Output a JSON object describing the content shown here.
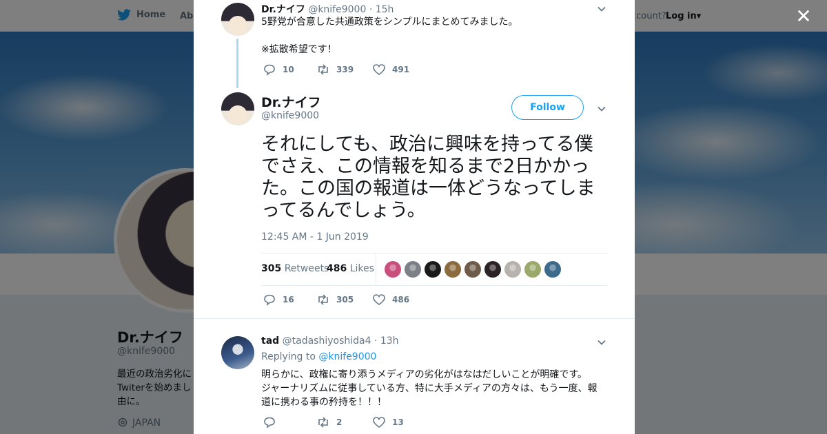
{
  "background": {
    "nav": {
      "home_label": "Home",
      "about_label": "Abo",
      "account_text": "ccount?",
      "login_label": "Log in"
    },
    "profile": {
      "name": "Dr.ナイフ",
      "handle": "@knife9000",
      "bio": "最近の政治劣化に\nTwiterを始めまし\n由に。",
      "location": "JAPAN"
    }
  },
  "close_label": "✕",
  "tweets": {
    "parent": {
      "name": "Dr.ナイフ",
      "handle": "@knife9000",
      "time": "· 15h",
      "text": "5野党が合意した共通政策をシンプルにまとめてみました。\n\n※拡散希望です！",
      "replies": "10",
      "retweets": "339",
      "likes": "491"
    },
    "main": {
      "name": "Dr.ナイフ",
      "handle": "@knife9000",
      "follow_label": "Follow",
      "text": "それにしても、政治に興味を持ってる僕でさえ、この情報を知るまで2日かかった。この国の報道は一体どうなってしまってるんでしょう。",
      "timestamp": "12:45 AM - 1 Jun 2019",
      "retweet_count": "305",
      "retweet_label": "Retweets",
      "like_count": "486",
      "like_label": "Likes",
      "likers": [
        {
          "color": "#c94f7c"
        },
        {
          "color": "#7d7f86"
        },
        {
          "color": "#1a1a1a"
        },
        {
          "color": "#8b6a3e"
        },
        {
          "color": "#6f5b4a"
        },
        {
          "color": "#2c2326"
        },
        {
          "color": "#b8b2ad"
        },
        {
          "color": "#9aa86a"
        },
        {
          "color": "#3b6a8a"
        }
      ],
      "replies": "16",
      "retweets": "305",
      "likes": "486"
    },
    "reply": {
      "name": "tad",
      "handle": "@tadashiyoshida4",
      "time": "· 13h",
      "replying_prefix": "Replying to",
      "replying_handle": "@knife9000",
      "text": "明らかに、政権に寄り添うメディアの劣化がはなはだしいことが明確です。\nジャーナリズムに従事している方、特に大手メディアの方々は、もう一度、報\n道に携わる事の矜持を！！！",
      "replies": "",
      "retweets": "2",
      "likes": "13"
    }
  },
  "colors": {
    "accent": "#1da1f2",
    "thread_line": "#a9d8f5",
    "text": "#14171a",
    "muted": "#657786"
  }
}
